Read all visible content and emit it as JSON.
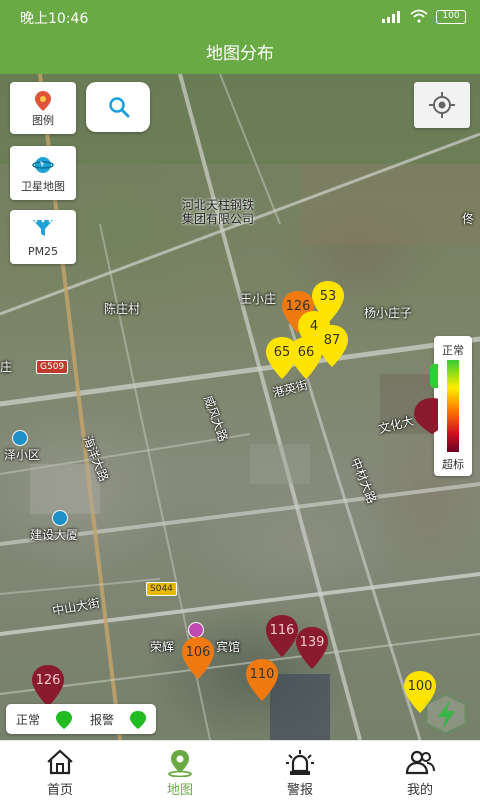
{
  "status_bar": {
    "time": "晚上10:46",
    "battery": "100"
  },
  "title": "地图分布",
  "tools": {
    "legend_label": "图例",
    "satellite_label": "卫星地图",
    "pm25_label": "PM25"
  },
  "scale": {
    "top": "正常",
    "bottom": "超标"
  },
  "status_legend": {
    "normal": "正常",
    "alarm": "报警",
    "normal_color": "#22bb22",
    "alarm_color": "#22bb22"
  },
  "map_labels": {
    "steel": "河北天柱钢铁",
    "steel2": "集团有限公司",
    "chenzhuang": "陈庄村",
    "wangxiaozhuang": "王小庄",
    "yangxiaozhuang": "杨小庄子",
    "gangying": "港英街",
    "wenhua": "文化大",
    "zhongcai": "中材大路",
    "weifeng": "威风大路",
    "haiyang": "海洋大路",
    "jianshe": "建设大厦",
    "zexiaoqu": "泽小区",
    "zhongshan": "中山大街",
    "ronghui": "荣辉",
    "hotel": "宾馆",
    "zhuang": "庄",
    "g509": "G509",
    "s044": "S044",
    "tiao": "佟"
  },
  "markers": [
    {
      "value": "53",
      "level": "yellow"
    },
    {
      "value": "126",
      "level": "orange"
    },
    {
      "value": "4",
      "level": "yellow"
    },
    {
      "value": "65",
      "level": "yellow"
    },
    {
      "value": "66",
      "level": "yellow"
    },
    {
      "value": "87",
      "level": "yellow"
    },
    {
      "value": "106",
      "level": "orange"
    },
    {
      "value": "110",
      "level": "orange"
    },
    {
      "value": "116",
      "level": "wine"
    },
    {
      "value": "139",
      "level": "wine"
    },
    {
      "value": "100",
      "level": "yellow"
    },
    {
      "value": "126",
      "level": "wine"
    }
  ],
  "colors": {
    "brand": "#6aaa45",
    "yellow": "#ffe400",
    "orange": "#f07a10",
    "wine": "#8a1a2e"
  },
  "tabs": [
    {
      "label": "首页",
      "icon": "home-icon"
    },
    {
      "label": "地图",
      "icon": "map-pin-icon"
    },
    {
      "label": "警报",
      "icon": "alarm-light-icon"
    },
    {
      "label": "我的",
      "icon": "user-group-icon"
    }
  ]
}
